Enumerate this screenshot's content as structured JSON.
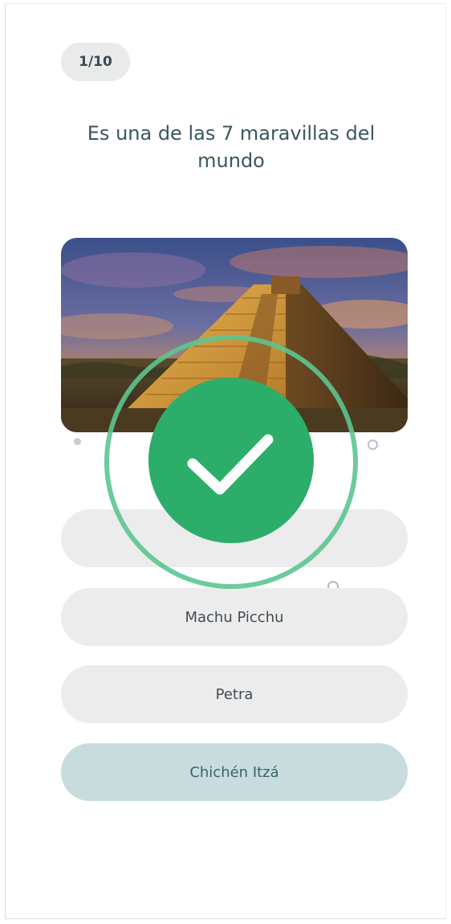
{
  "quiz": {
    "progress": "1/10",
    "question": "Es una de las 7 maravillas del mundo",
    "image": {
      "subject": "pyramid-photo"
    },
    "options": [
      {
        "label": "",
        "state": "default"
      },
      {
        "label": "Machu Picchu",
        "state": "default"
      },
      {
        "label": "Petra",
        "state": "default"
      },
      {
        "label": "Chichén Itzá",
        "state": "selected"
      }
    ],
    "feedback": {
      "icon": "check-icon",
      "result": "correct"
    }
  },
  "colors": {
    "success": "#2cae6a",
    "success_ring": "#5cc590",
    "option_bg": "#ececec",
    "selected_bg": "#c8dcde",
    "question_text": "#3b5660"
  }
}
